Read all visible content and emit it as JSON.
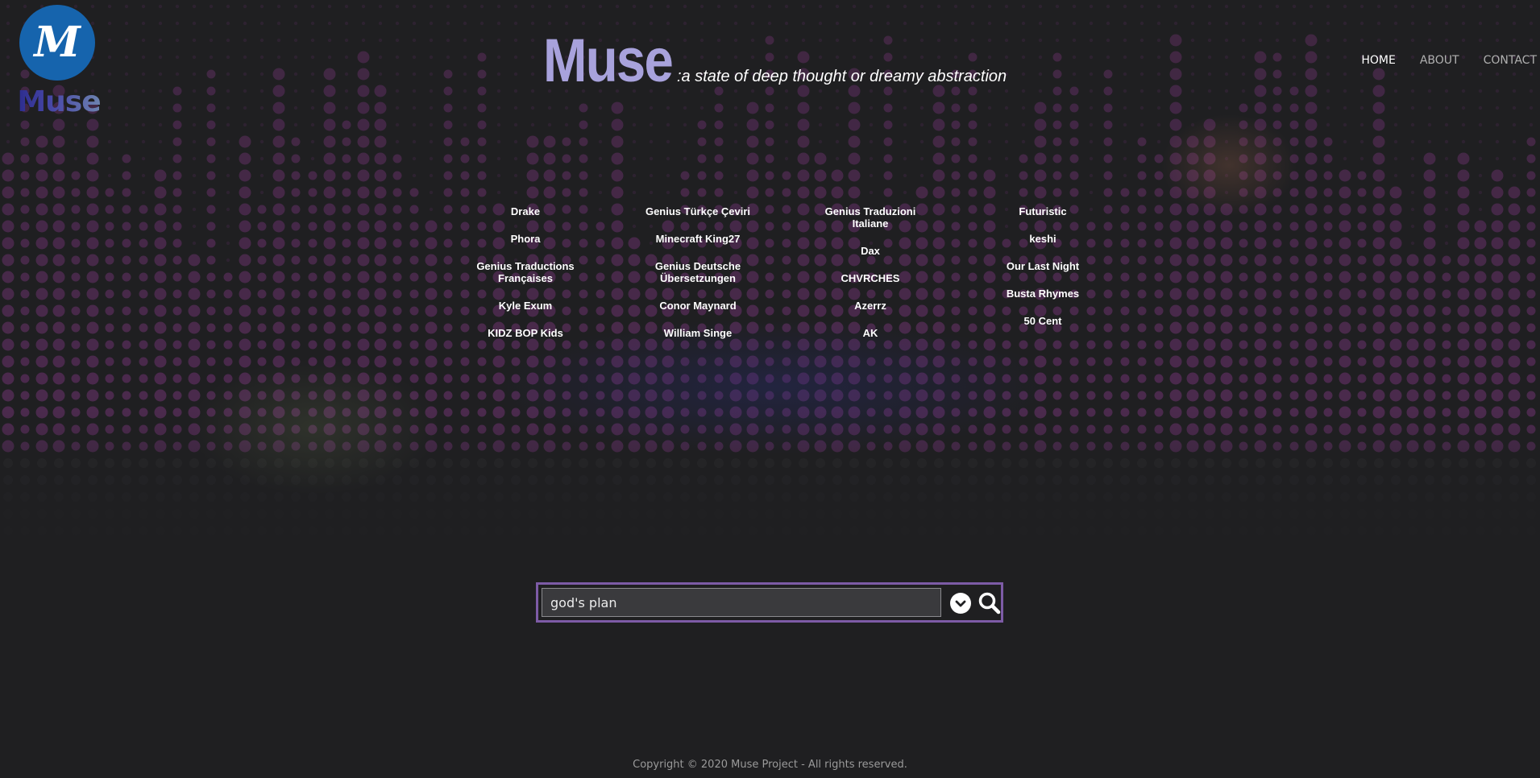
{
  "brand": {
    "logo_monogram": "M",
    "logo_word": "Muse",
    "logo_color": "#1664ad"
  },
  "hero": {
    "title": "Muse",
    "subtitle": ":a state of deep thought or dreamy abstraction",
    "title_color": "#a8a2dc"
  },
  "nav": {
    "home": "HOME",
    "about": "ABOUT",
    "contact": "CONTACT"
  },
  "artists": {
    "columns": [
      [
        "Drake",
        "Phora",
        "Genius Traductions Françaises",
        "Kyle Exum",
        "KIDZ BOP Kids"
      ],
      [
        "Genius Türkçe Çeviri",
        "Minecraft King27",
        "Genius Deutsche Übersetzungen",
        "Conor Maynard",
        "William Singe"
      ],
      [
        "Genius Traduzioni Italiane",
        "Dax",
        "CHVRCHES",
        "Azerrz",
        "AK"
      ],
      [
        "Futuristic",
        "keshi",
        "Our Last Night",
        "Busta Rhymes",
        "50 Cent"
      ]
    ]
  },
  "search": {
    "value": "god's plan",
    "dropdown_icon": "chevron-down-circle",
    "search_icon": "magnifier",
    "border_color": "#7d5ba6"
  },
  "footer": {
    "copyright": "Copyright © 2020 Muse Project - All rights reserved."
  }
}
